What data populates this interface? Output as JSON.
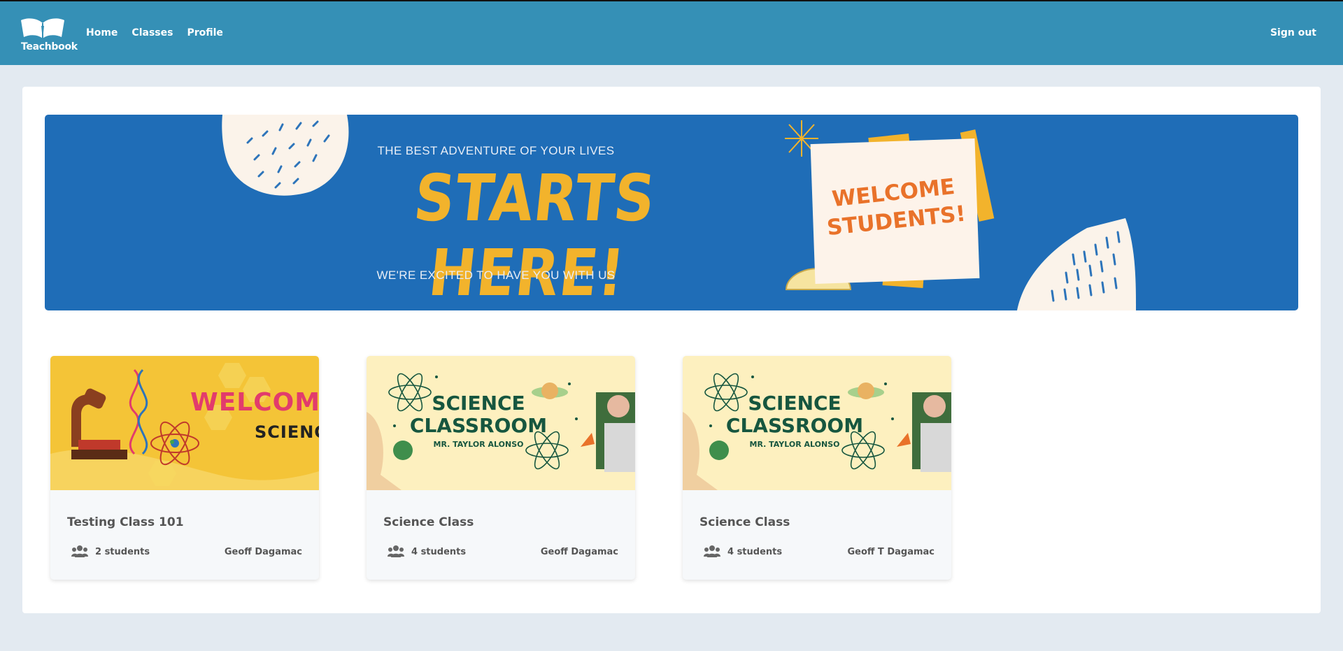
{
  "navbar": {
    "brand": "Teachbook",
    "links": [
      "Home",
      "Classes",
      "Profile"
    ],
    "signout": "Sign out"
  },
  "banner": {
    "tagline_top": "THE BEST ADVENTURE OF YOUR LIVES",
    "headline": "STARTS HERE!",
    "tagline_bottom": "WE'RE EXCITED TO HAVE YOU WITH US",
    "note": [
      "WELCOME",
      "STUDENTS!"
    ]
  },
  "classes": [
    {
      "title": "Testing Class 101",
      "students": "2 students",
      "teacher": "Geoff Dagamac",
      "image_text": [
        "WELCOME",
        "SCIENC"
      ]
    },
    {
      "title": "Science Class",
      "students": "4 students",
      "teacher": "Geoff Dagamac",
      "image_text": [
        "SCIENCE",
        "CLASSROOM",
        "MR. TAYLOR ALONSO"
      ]
    },
    {
      "title": "Science Class",
      "students": "4 students",
      "teacher": "Geoff T Dagamac",
      "image_text": [
        "SCIENCE",
        "CLASSROOM",
        "MR. TAYLOR ALONSO"
      ]
    }
  ],
  "colors": {
    "navbar": "#3590b6",
    "banner": "#1f6db7",
    "headline": "#f2b32c",
    "page_bg": "#e3eaf1"
  }
}
